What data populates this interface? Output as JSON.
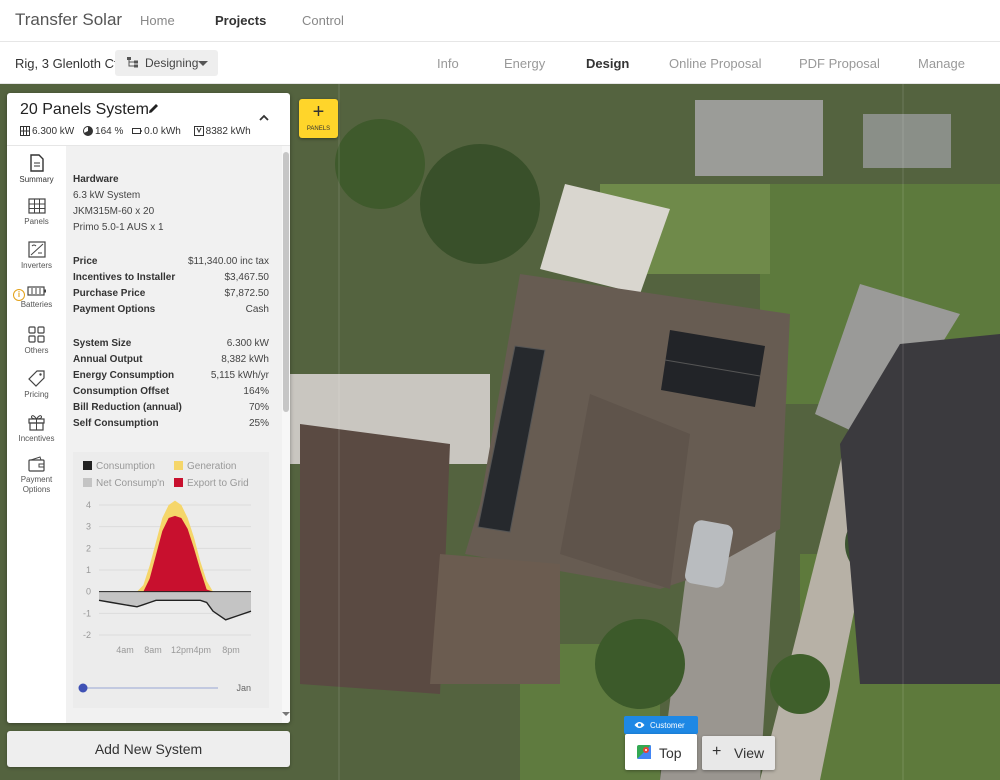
{
  "app": {
    "title": "Transfer Solar"
  },
  "top_nav": [
    {
      "label": "Home"
    },
    {
      "label": "Projects"
    },
    {
      "label": "Control"
    }
  ],
  "project": {
    "address": "Rig, 3 Glenloth Ct",
    "mode_dropdown": "Designing"
  },
  "sub_tabs": [
    {
      "label": "Info"
    },
    {
      "label": "Energy"
    },
    {
      "label": "Design"
    },
    {
      "label": "Online Proposal"
    },
    {
      "label": "PDF Proposal"
    },
    {
      "label": "Manage"
    }
  ],
  "active_sub_tab": "Design",
  "panel": {
    "title": "20 Panels System",
    "stats": {
      "size": "6.300 kW",
      "offset": "164 %",
      "battery": "0.0 kWh",
      "output": "8382 kWh"
    }
  },
  "side_nav": [
    {
      "label": "Summary",
      "icon": "document-icon"
    },
    {
      "label": "Panels",
      "icon": "solar-panel-icon"
    },
    {
      "label": "Inverters",
      "icon": "inverter-icon"
    },
    {
      "label": "Batteries",
      "icon": "battery-icon"
    },
    {
      "label": "Others",
      "icon": "grid-icon"
    },
    {
      "label": "Pricing",
      "icon": "tag-icon"
    },
    {
      "label": "Incentives",
      "icon": "gift-icon"
    },
    {
      "label": "Payment Options",
      "icon": "wallet-icon"
    }
  ],
  "summary": {
    "hardware_title": "Hardware",
    "hardware": [
      "6.3 kW System",
      "JKM315M-60 x 20",
      "Primo 5.0-1 AUS x 1"
    ],
    "pricing": [
      {
        "label": "Price",
        "value": "$11,340.00 inc tax"
      },
      {
        "label": "Incentives to Installer",
        "value": "$3,467.50"
      },
      {
        "label": "Purchase Price",
        "value": "$7,872.50"
      },
      {
        "label": "Payment Options",
        "value": "Cash"
      }
    ],
    "system": [
      {
        "label": "System Size",
        "value": "6.300 kW"
      },
      {
        "label": "Annual Output",
        "value": "8,382 kWh"
      },
      {
        "label": "Energy Consumption",
        "value": "5,115 kWh/yr"
      },
      {
        "label": "Consumption Offset",
        "value": "164%"
      },
      {
        "label": "Bill Reduction (annual)",
        "value": "70%"
      },
      {
        "label": "Self Consumption",
        "value": "25%"
      }
    ]
  },
  "chart_data": {
    "type": "area",
    "legend": [
      {
        "name": "Consumption",
        "color": "#222222"
      },
      {
        "name": "Generation",
        "color": "#f5d66a"
      },
      {
        "name": "Net Consump'n",
        "color": "#c4c4c4"
      },
      {
        "name": "Export to Grid",
        "color": "#c8102e"
      }
    ],
    "y_ticks": [
      "4",
      "3",
      "2",
      "1",
      "0",
      "-1",
      "-2"
    ],
    "ylim": [
      -2,
      4
    ],
    "x_ticks": [
      "4am",
      "8am",
      "12pm4pm",
      "8pm"
    ],
    "x": [
      0,
      2,
      4,
      6,
      7,
      8,
      9,
      10,
      11,
      12,
      13,
      14,
      15,
      16,
      17,
      18,
      20,
      22,
      24
    ],
    "series": [
      {
        "name": "Generation",
        "values": [
          0,
          0,
          0,
          0,
          0.3,
          1.2,
          2.3,
          3.4,
          4.0,
          4.2,
          4.0,
          3.4,
          2.5,
          1.4,
          0.5,
          0,
          0,
          0,
          0
        ]
      },
      {
        "name": "Export to Grid",
        "values": [
          0,
          0,
          0,
          0,
          0,
          0.6,
          1.7,
          2.8,
          3.4,
          3.5,
          3.4,
          2.9,
          2.0,
          1.0,
          0.1,
          0,
          0,
          0,
          0
        ]
      },
      {
        "name": "Consumption",
        "values": [
          -0.4,
          -0.5,
          -0.6,
          -0.7,
          -0.6,
          -0.5,
          -0.4,
          -0.4,
          -0.4,
          -0.4,
          -0.4,
          -0.4,
          -0.4,
          -0.4,
          -0.5,
          -0.9,
          -1.3,
          -1.1,
          -0.9
        ]
      }
    ],
    "slider_label": "Jan",
    "slider_position": 0
  },
  "actions": {
    "add_system": "Add New System",
    "panels_button": "PANELS",
    "customer_tag": "Customer",
    "top_button": "Top",
    "view_button": "View"
  }
}
